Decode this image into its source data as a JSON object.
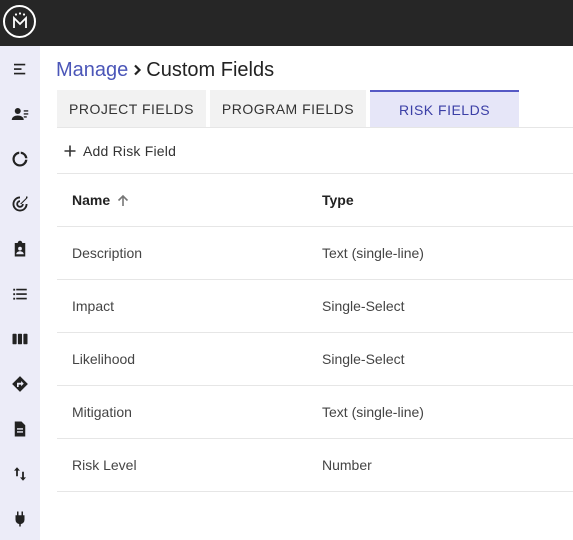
{
  "app": {
    "logo_icon": "crown-m-logo-icon"
  },
  "colors": {
    "topbar": "#262626",
    "sidebar": "#ececf8",
    "link": "#4b56b8",
    "active_tab_bg": "#e6e6f8",
    "active_tab_text": "#3b3fa6"
  },
  "sidebar": {
    "items": [
      {
        "icon": "menu-collapse-icon"
      },
      {
        "icon": "users-icon"
      },
      {
        "icon": "donut-chart-icon"
      },
      {
        "icon": "target-icon"
      },
      {
        "icon": "clipboard-user-icon"
      },
      {
        "icon": "list-icon"
      },
      {
        "icon": "columns-icon"
      },
      {
        "icon": "route-icon"
      },
      {
        "icon": "document-icon"
      },
      {
        "icon": "sort-arrows-icon"
      },
      {
        "icon": "plug-icon"
      }
    ]
  },
  "breadcrumb": {
    "root": "Manage",
    "current": "Custom Fields"
  },
  "tabs": [
    {
      "label": "PROJECT FIELDS",
      "active": false
    },
    {
      "label": "PROGRAM FIELDS",
      "active": false
    },
    {
      "label": "RISK FIELDS",
      "active": true
    }
  ],
  "toolbar": {
    "add_label": "Add Risk Field"
  },
  "table": {
    "columns": {
      "name": "Name",
      "type": "Type"
    },
    "rows": [
      {
        "name": "Description",
        "type": "Text (single-line)"
      },
      {
        "name": "Impact",
        "type": "Single-Select"
      },
      {
        "name": "Likelihood",
        "type": "Single-Select"
      },
      {
        "name": "Mitigation",
        "type": "Text (single-line)"
      },
      {
        "name": "Risk Level",
        "type": "Number"
      }
    ]
  }
}
